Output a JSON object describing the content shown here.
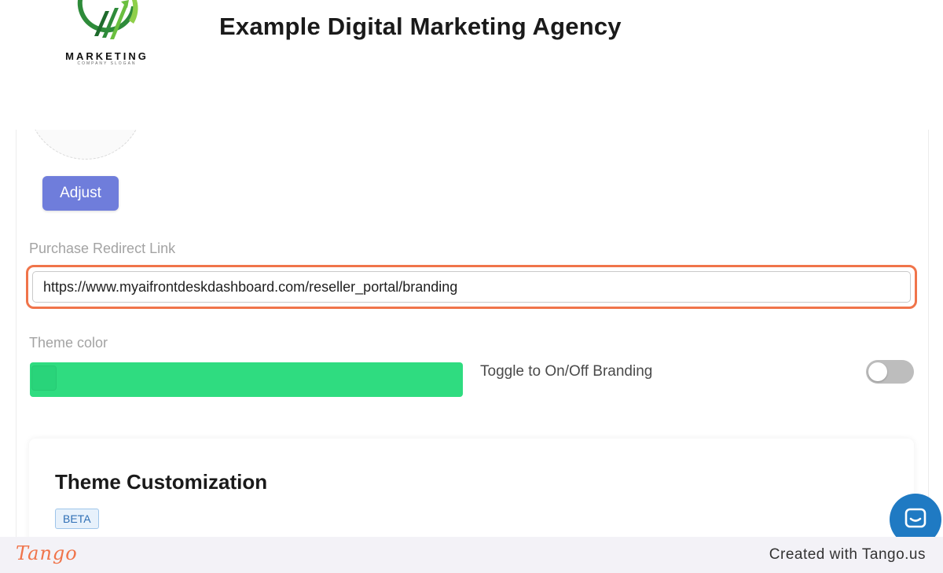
{
  "header": {
    "logo_text": "MARKETING",
    "logo_slogan": "COMPANY SLOGAN",
    "agency_title": "Example Digital Marketing Agency"
  },
  "form": {
    "adjust_label": "Adjust",
    "redirect_label": "Purchase Redirect Link",
    "redirect_value": "https://www.myaifrontdeskdashboard.com/reseller_portal/branding",
    "theme_color_label": "Theme color",
    "theme_color": "#2fdc80",
    "toggle_label": "Toggle to On/Off Branding",
    "branding_toggle_on": false
  },
  "card": {
    "title": "Theme Customization",
    "badge": "BETA"
  },
  "chat": {
    "icon": "chat-bubble-icon"
  },
  "footer": {
    "brand": "Tango",
    "credit": "Created with Tango.us"
  },
  "colors": {
    "accent_button": "#6f7ddb",
    "highlight": "#f0744a",
    "chat": "#1f7ac3"
  }
}
